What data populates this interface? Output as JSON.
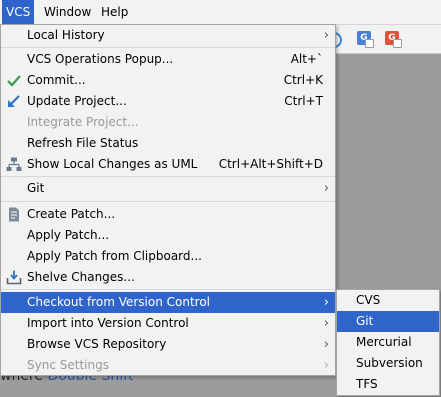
{
  "menubar": {
    "items": [
      {
        "label": "VCS",
        "active": true
      },
      {
        "label": "Window",
        "active": false
      },
      {
        "label": "Help",
        "active": false
      }
    ]
  },
  "background": {
    "hint_prefix": "where ",
    "hint_key": "Double Shift"
  },
  "toolbar": {
    "icons": [
      {
        "name": "google-translate-icon",
        "glyph": "G",
        "color": "#4a7fd8"
      },
      {
        "name": "translate-icon",
        "glyph": "G",
        "color": "#e0533a"
      }
    ]
  },
  "vcs_menu": {
    "items": [
      {
        "label": "Local History",
        "shortcut": "",
        "submenu": true,
        "enabled": true,
        "highlighted": false,
        "icon": null
      },
      {
        "label": "VCS Operations Popup...",
        "shortcut": "Alt+`",
        "submenu": false,
        "enabled": true,
        "highlighted": false,
        "icon": null
      },
      {
        "label": "Commit...",
        "shortcut": "Ctrl+K",
        "submenu": false,
        "enabled": true,
        "highlighted": false,
        "icon": "checkmark-icon"
      },
      {
        "label": "Update Project...",
        "shortcut": "Ctrl+T",
        "submenu": false,
        "enabled": true,
        "highlighted": false,
        "icon": "update-arrow-icon"
      },
      {
        "label": "Integrate Project...",
        "shortcut": "",
        "submenu": false,
        "enabled": false,
        "highlighted": false,
        "icon": null
      },
      {
        "label": "Refresh File Status",
        "shortcut": "",
        "submenu": false,
        "enabled": true,
        "highlighted": false,
        "icon": null
      },
      {
        "label": "Show Local Changes as UML",
        "shortcut": "Ctrl+Alt+Shift+D",
        "submenu": false,
        "enabled": true,
        "highlighted": false,
        "icon": "uml-diagram-icon"
      },
      {
        "label": "Git",
        "shortcut": "",
        "submenu": true,
        "enabled": true,
        "highlighted": false,
        "icon": null
      },
      {
        "label": "Create Patch...",
        "shortcut": "",
        "submenu": false,
        "enabled": true,
        "highlighted": false,
        "icon": "patch-file-icon"
      },
      {
        "label": "Apply Patch...",
        "shortcut": "",
        "submenu": false,
        "enabled": true,
        "highlighted": false,
        "icon": null
      },
      {
        "label": "Apply Patch from Clipboard...",
        "shortcut": "",
        "submenu": false,
        "enabled": true,
        "highlighted": false,
        "icon": null
      },
      {
        "label": "Shelve Changes...",
        "shortcut": "",
        "submenu": false,
        "enabled": true,
        "highlighted": false,
        "icon": "shelve-icon"
      },
      {
        "label": "Checkout from Version Control",
        "shortcut": "",
        "submenu": true,
        "enabled": true,
        "highlighted": true,
        "icon": null
      },
      {
        "label": "Import into Version Control",
        "shortcut": "",
        "submenu": true,
        "enabled": true,
        "highlighted": false,
        "icon": null
      },
      {
        "label": "Browse VCS Repository",
        "shortcut": "",
        "submenu": true,
        "enabled": true,
        "highlighted": false,
        "icon": null
      },
      {
        "label": "Sync Settings",
        "shortcut": "",
        "submenu": true,
        "enabled": false,
        "highlighted": false,
        "icon": null
      }
    ]
  },
  "checkout_submenu": {
    "items": [
      {
        "label": "CVS",
        "highlighted": false
      },
      {
        "label": "Git",
        "highlighted": true
      },
      {
        "label": "Mercurial",
        "highlighted": false
      },
      {
        "label": "Subversion",
        "highlighted": false
      },
      {
        "label": "TFS",
        "highlighted": false
      }
    ]
  },
  "colors": {
    "selection": "#2f65ca",
    "menu_bg": "#f2f2f2",
    "disabled_text": "#999999",
    "link": "#2d59a8"
  }
}
